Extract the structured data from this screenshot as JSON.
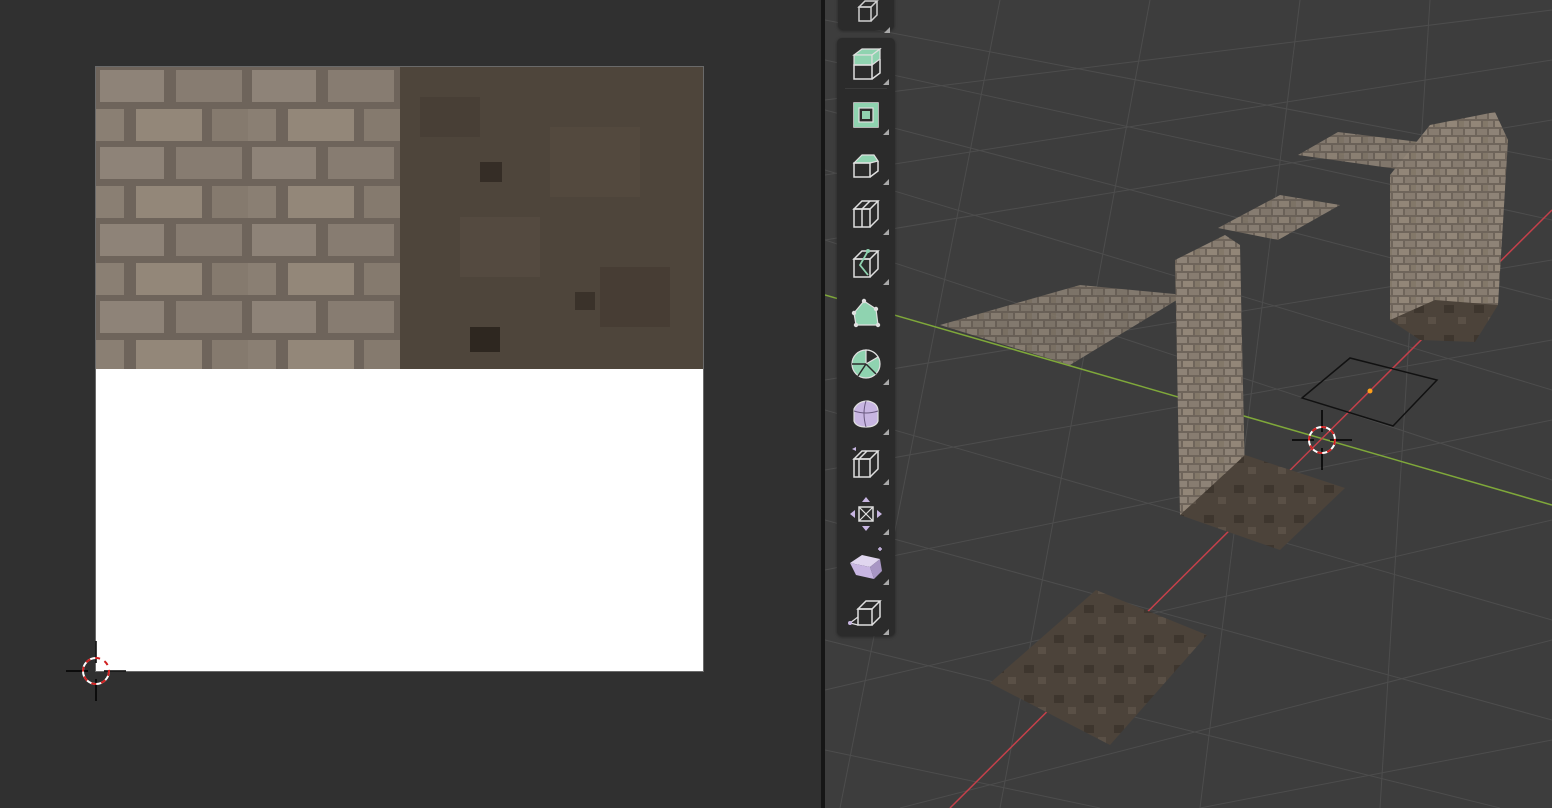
{
  "uv_editor": {
    "image": {
      "textures": [
        "brick-tiles",
        "dirt-ground"
      ],
      "empty_region_color": "#ffffff"
    },
    "background_color": "#303030"
  },
  "viewport": {
    "background_color": "#3d3d3d",
    "x_axis_color": "#c4404a",
    "y_axis_color": "#7fa83a",
    "objects": [
      "brick-floor-plane",
      "brick-wall-left",
      "dirt-floor-under-wall",
      "brick-ledge-plane",
      "brick-top-plane",
      "brick-tower",
      "dirt-floor-tower",
      "selected-plane",
      "dirt-floor-front"
    ]
  },
  "toolbar": {
    "tools": [
      {
        "name": "select-box-tool",
        "icon": "cube-outline-icon"
      },
      {
        "name": "extrude-region-tool",
        "icon": "extrude-icon"
      },
      {
        "name": "inset-faces-tool",
        "icon": "inset-icon"
      },
      {
        "name": "bevel-tool",
        "icon": "bevel-icon"
      },
      {
        "name": "loop-cut-tool",
        "icon": "loop-cut-icon"
      },
      {
        "name": "knife-tool",
        "icon": "knife-icon"
      },
      {
        "name": "poly-build-tool",
        "icon": "poly-build-icon"
      },
      {
        "name": "spin-tool",
        "icon": "spin-icon"
      },
      {
        "name": "smooth-tool",
        "icon": "smooth-icon"
      },
      {
        "name": "edge-slide-tool",
        "icon": "edge-slide-icon"
      },
      {
        "name": "shrink-fatten-tool",
        "icon": "shrink-fatten-icon"
      },
      {
        "name": "shear-tool",
        "icon": "shear-icon"
      },
      {
        "name": "rip-region-tool",
        "icon": "rip-icon"
      }
    ],
    "accent_green": "#8fd3b0",
    "accent_purple": "#c8b6e2"
  }
}
